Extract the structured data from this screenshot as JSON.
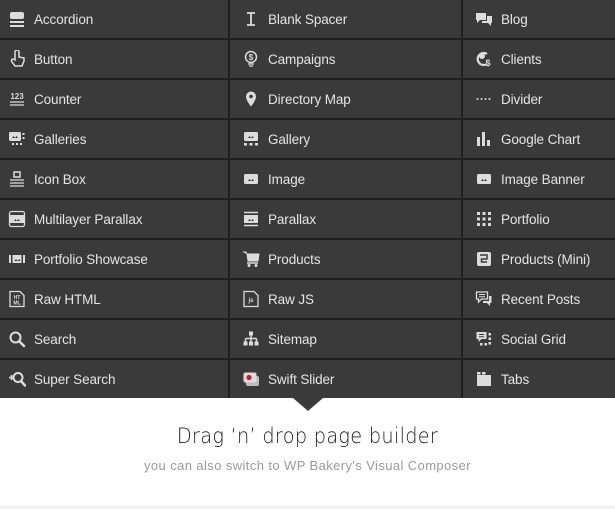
{
  "elements": [
    {
      "label": "Accordion",
      "icon": "accordion-icon"
    },
    {
      "label": "Blank Spacer",
      "icon": "spacer-icon"
    },
    {
      "label": "Blog",
      "icon": "blog-icon"
    },
    {
      "label": "Button",
      "icon": "button-icon"
    },
    {
      "label": "Campaigns",
      "icon": "campaigns-icon"
    },
    {
      "label": "Clients",
      "icon": "clients-icon"
    },
    {
      "label": "Counter",
      "icon": "counter-icon"
    },
    {
      "label": "Directory Map",
      "icon": "map-pin-icon"
    },
    {
      "label": "Divider",
      "icon": "divider-icon"
    },
    {
      "label": "Galleries",
      "icon": "galleries-icon"
    },
    {
      "label": "Gallery",
      "icon": "gallery-icon"
    },
    {
      "label": "Google Chart",
      "icon": "chart-icon"
    },
    {
      "label": "Icon Box",
      "icon": "icon-box-icon"
    },
    {
      "label": "Image",
      "icon": "image-icon"
    },
    {
      "label": "Image Banner",
      "icon": "image-banner-icon"
    },
    {
      "label": "Multilayer Parallax",
      "icon": "multilayer-parallax-icon"
    },
    {
      "label": "Parallax",
      "icon": "parallax-icon"
    },
    {
      "label": "Portfolio",
      "icon": "portfolio-icon"
    },
    {
      "label": "Portfolio Showcase",
      "icon": "portfolio-showcase-icon"
    },
    {
      "label": "Products",
      "icon": "cart-icon"
    },
    {
      "label": "Products (Mini)",
      "icon": "products-mini-icon"
    },
    {
      "label": "Raw HTML",
      "icon": "raw-html-icon"
    },
    {
      "label": "Raw JS",
      "icon": "raw-js-icon"
    },
    {
      "label": "Recent Posts",
      "icon": "recent-posts-icon"
    },
    {
      "label": "Search",
      "icon": "search-icon"
    },
    {
      "label": "Sitemap",
      "icon": "sitemap-icon"
    },
    {
      "label": "Social Grid",
      "icon": "social-grid-icon"
    },
    {
      "label": "Super Search",
      "icon": "super-search-icon"
    },
    {
      "label": "Swift Slider",
      "icon": "swift-slider-icon"
    },
    {
      "label": "Tabs",
      "icon": "tabs-icon"
    }
  ],
  "headline": "Drag ‘n’ drop page builder",
  "subheadline": "you can also switch to WP Bakery's Visual Composer",
  "colors": {
    "cell_bg": "#3a3a3a",
    "grid_line": "#1f1f1f",
    "label": "#e4e4e4",
    "icon": "#dcdcdc",
    "slider_accent": "#c8202a"
  }
}
